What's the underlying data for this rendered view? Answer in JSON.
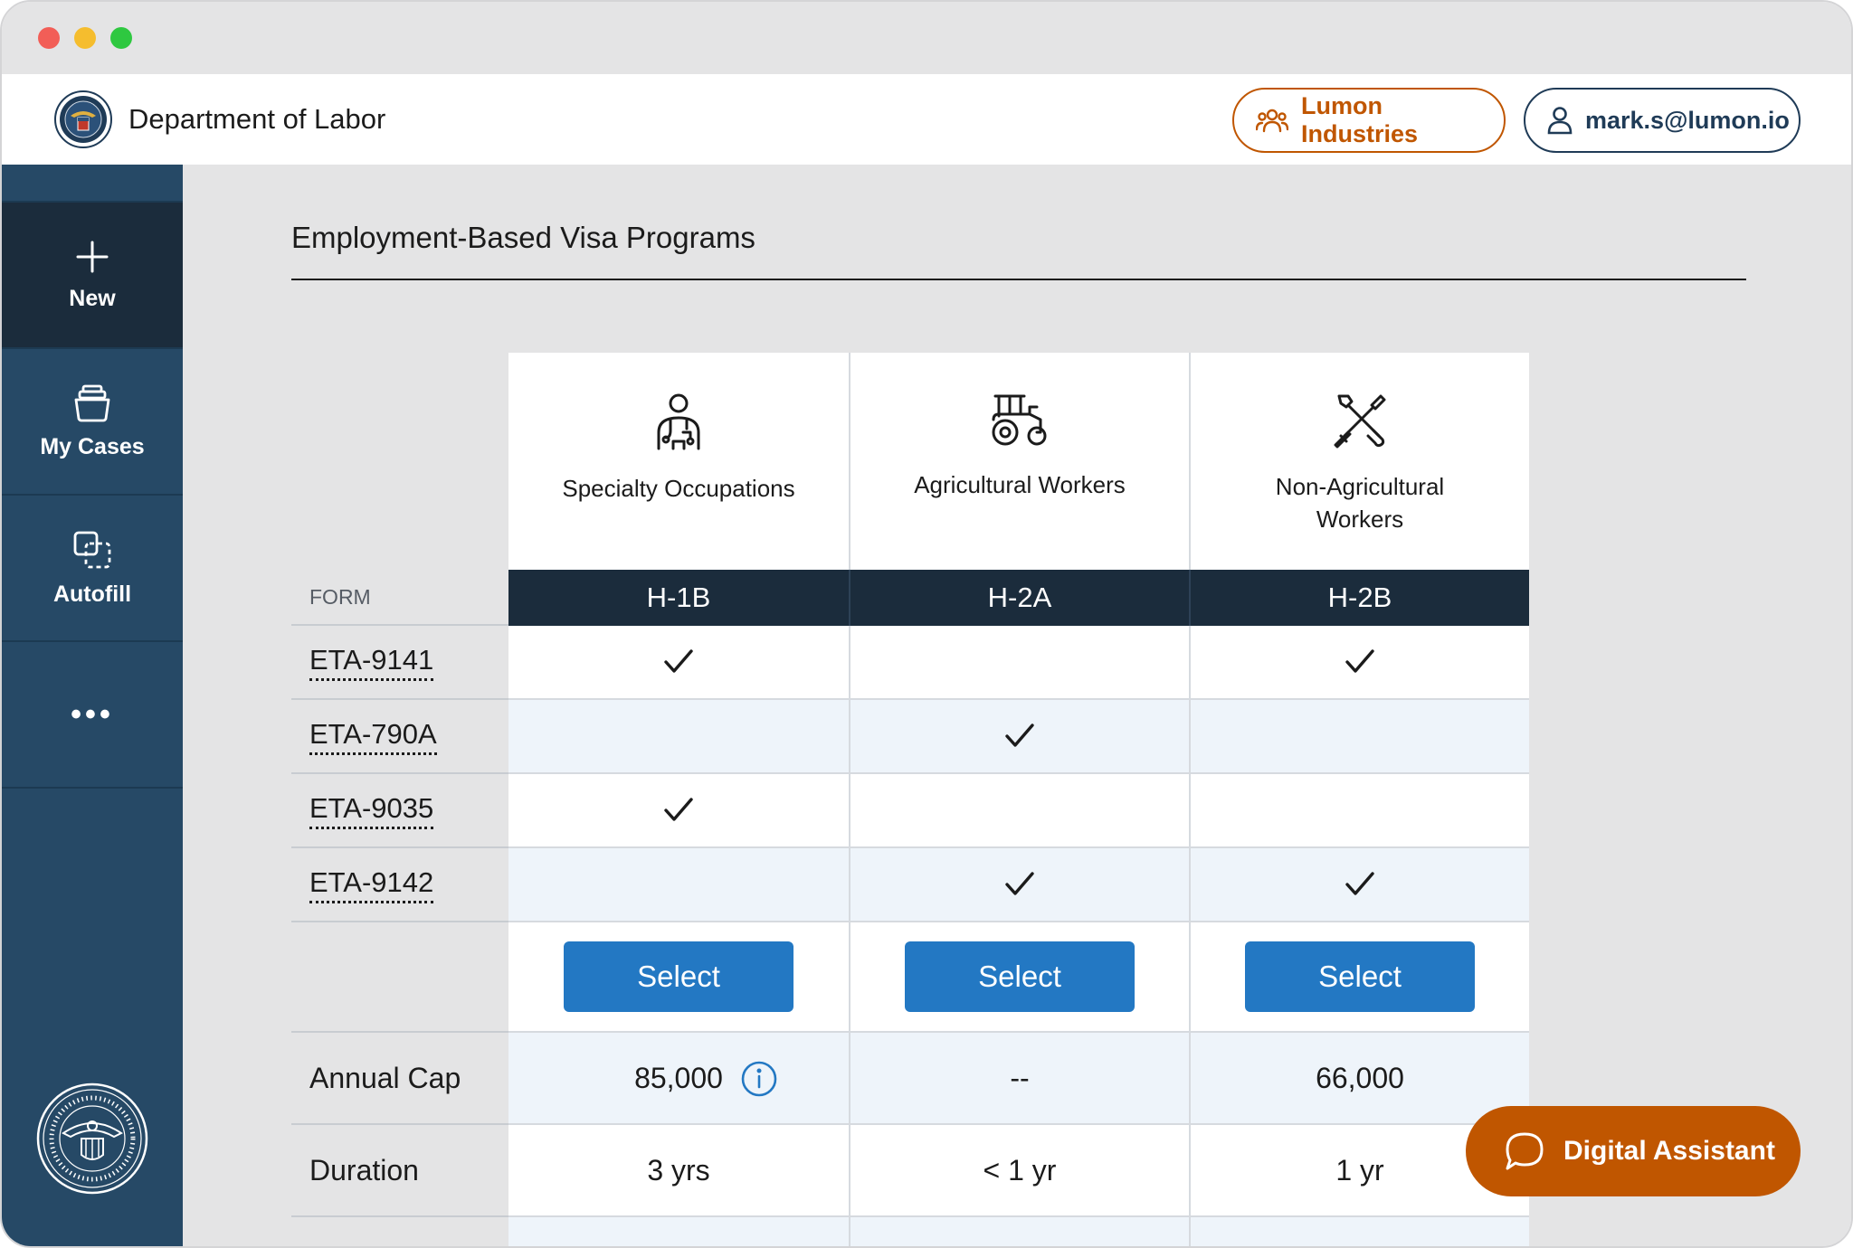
{
  "header": {
    "title": "Department of Labor",
    "org_label": "Lumon Industries",
    "user_email": "mark.s@lumon.io"
  },
  "sidebar": {
    "items": [
      {
        "label": "New",
        "icon": "plus-icon"
      },
      {
        "label": "My Cases",
        "icon": "cases-icon"
      },
      {
        "label": "Autofill",
        "icon": "autofill-icon"
      },
      {
        "label": "•••",
        "icon": "more-icon"
      }
    ]
  },
  "page": {
    "title": "Employment-Based Visa Programs"
  },
  "table": {
    "form_header": "FORM",
    "columns": [
      {
        "name": "Specialty Occupations",
        "icon": "worker-icon",
        "code": "H-1B",
        "select_label": "Select",
        "annual_cap": "85,000",
        "duration": "3 yrs"
      },
      {
        "name": "Agricultural Workers",
        "icon": "tractor-icon",
        "code": "H-2A",
        "select_label": "Select",
        "annual_cap": "--",
        "duration": "< 1 yr"
      },
      {
        "name": "Non-Agricultural Workers",
        "icon": "tools-icon",
        "code": "H-2B",
        "select_label": "Select",
        "annual_cap": "66,000",
        "duration": "1 yr"
      }
    ],
    "forms": [
      {
        "name": "ETA-9141",
        "checks": [
          true,
          false,
          true
        ]
      },
      {
        "name": "ETA-790A",
        "checks": [
          false,
          true,
          false
        ]
      },
      {
        "name": "ETA-9035",
        "checks": [
          true,
          false,
          false
        ]
      },
      {
        "name": "ETA-9142",
        "checks": [
          false,
          true,
          true
        ]
      }
    ],
    "stats": [
      {
        "label": "Annual Cap",
        "key": "annual_cap"
      },
      {
        "label": "Duration",
        "key": "duration"
      }
    ],
    "check_glyph": "✓"
  },
  "assistant": {
    "label": "Digital Assistant"
  },
  "colors": {
    "sidebar": "#264966",
    "sidebar_active": "#1b2c3c",
    "primary": "#2378c3",
    "accent": "#c05600",
    "form_header": "#1b2c3c"
  }
}
